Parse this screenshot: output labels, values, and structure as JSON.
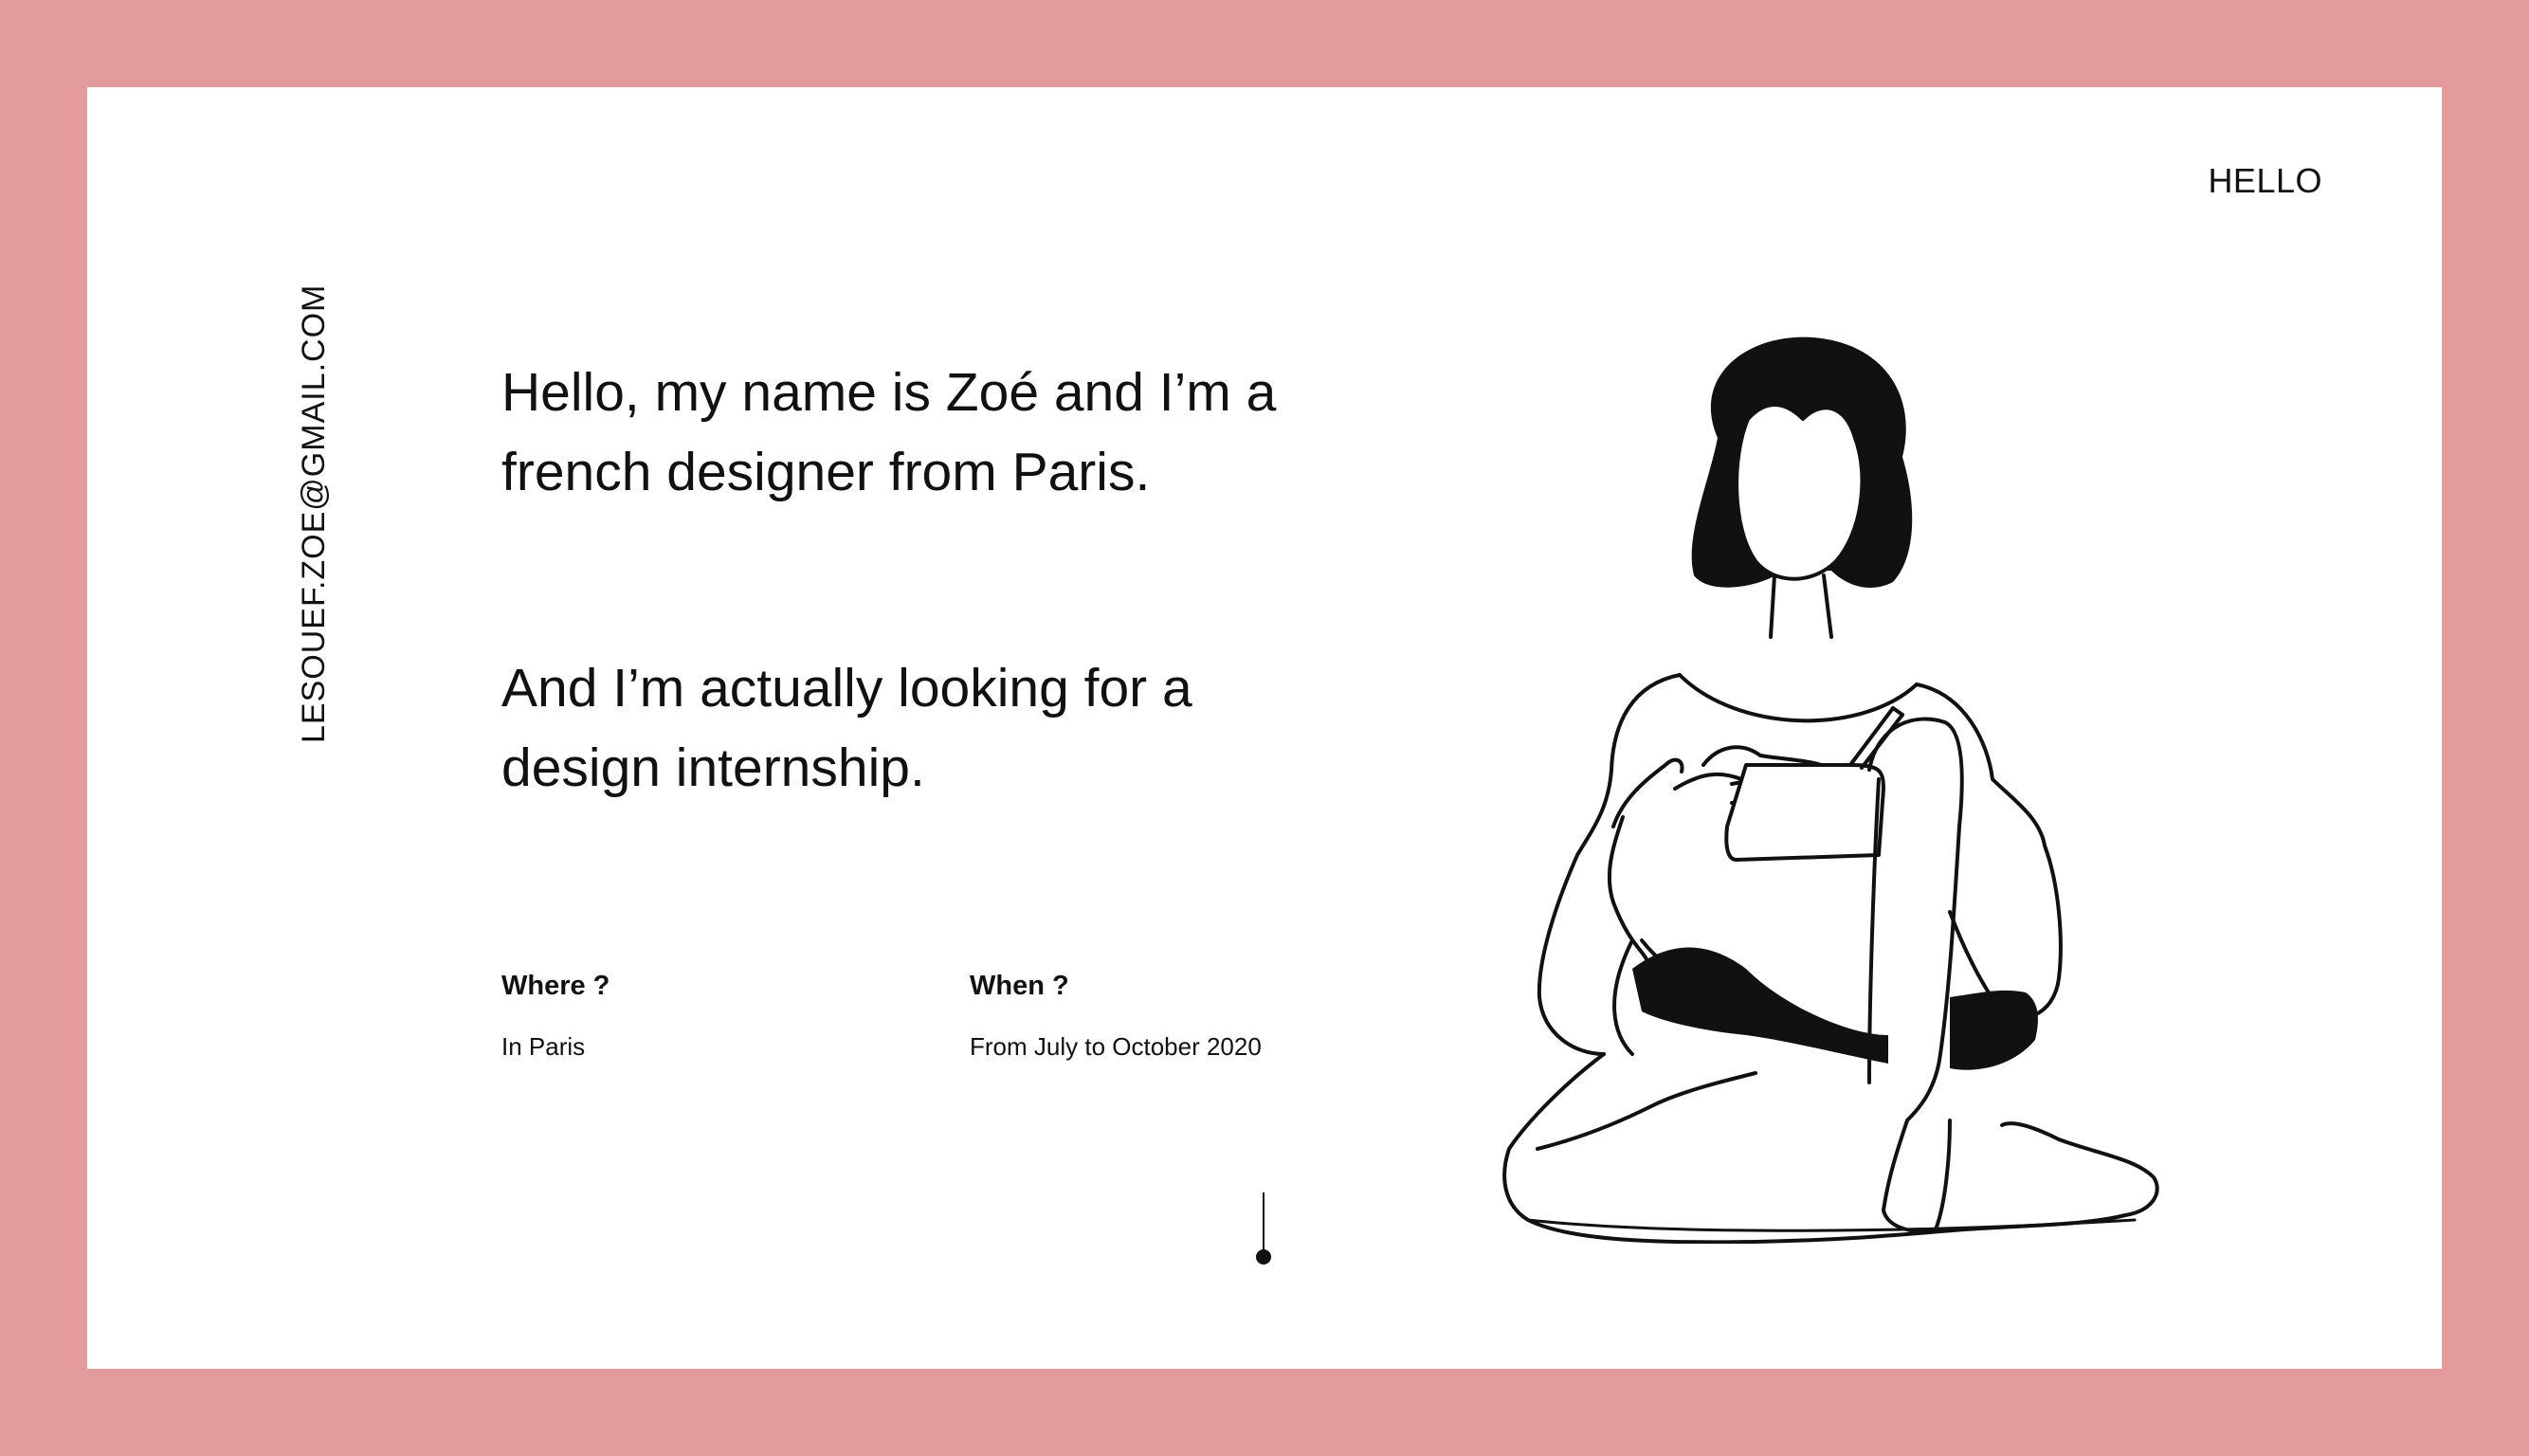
{
  "sidebar": {
    "email": "LESOUEF.ZOE@GMAIL.COM"
  },
  "nav": {
    "hello": "HELLO"
  },
  "intro": {
    "line1": "Hello, my name is Zoé and I’m a french designer from Paris.",
    "line2": "And I’m actually looking for a design internship."
  },
  "details": {
    "where_label": "Where ?",
    "where_value": "In Paris",
    "when_label": "When ?",
    "when_value": "From July to October 2020"
  },
  "colors": {
    "background": "#e39b9c",
    "card": "#ffffff",
    "ink": "#111111"
  },
  "icons": {
    "scroll": "scroll-down-indicator-icon",
    "illustration": "woman-sketching-illustration"
  }
}
